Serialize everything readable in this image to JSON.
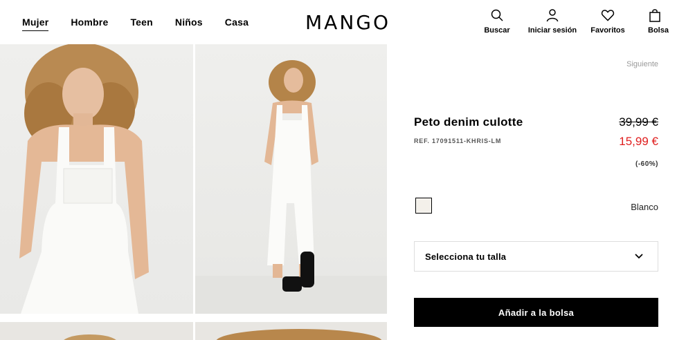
{
  "nav": {
    "items": [
      {
        "label": "Mujer",
        "active": true
      },
      {
        "label": "Hombre"
      },
      {
        "label": "Teen"
      },
      {
        "label": "Niños"
      },
      {
        "label": "Casa"
      }
    ]
  },
  "brand": {
    "logo": "MANGO"
  },
  "actions": {
    "search": "Buscar",
    "login": "Iniciar sesión",
    "favorites": "Favoritos",
    "bag": "Bolsa"
  },
  "product": {
    "next_link": "Siguiente",
    "name": "Peto denim culotte",
    "ref": "REF. 17091511-KHRIS-LM",
    "price_old": "39,99 €",
    "price_new": "15,99 €",
    "discount": "(-60%)",
    "color": "Blanco",
    "size_placeholder": "Selecciona tu talla",
    "add_button": "Añadir a la bolsa"
  },
  "colors": {
    "sale_red": "#e01d1d",
    "swatch": "#f3f0ea"
  }
}
